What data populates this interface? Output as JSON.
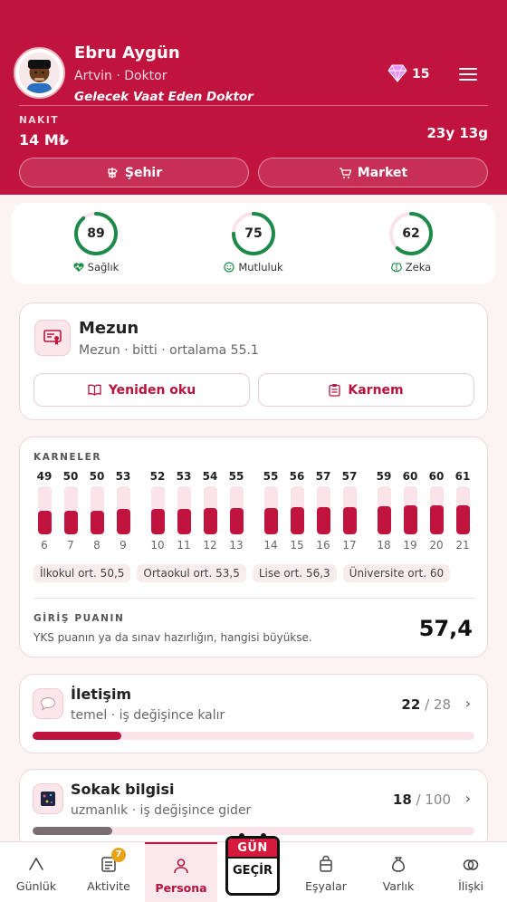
{
  "profile": {
    "name": "Ebru Aygün",
    "location": "Artvin · Doktor",
    "title": "Gelecek Vaat Eden Doktor",
    "gems": "15",
    "cash_label": "NAKIT",
    "cash": "14 M₺",
    "age": "23y 13g"
  },
  "header_buttons": {
    "city": "Şehir",
    "market": "Market"
  },
  "stats": [
    {
      "label": "Sağlık",
      "value": 89,
      "color": "#1e8a4a",
      "icon": "heart-pulse-icon"
    },
    {
      "label": "Mutluluk",
      "value": 75,
      "color": "#1e8a4a",
      "icon": "smile-icon"
    },
    {
      "label": "Zeka",
      "value": 62,
      "color": "#1e8a4a",
      "icon": "brain-icon"
    }
  ],
  "education": {
    "title": "Mezun",
    "subtitle": "Mezun · bitti · ortalama 55.1",
    "reread_label": "Yeniden oku",
    "report_label": "Karnem"
  },
  "report_cards": {
    "label": "KARNELER",
    "chips": [
      "İlkokul ort. 50,5",
      "Ortaokul ort. 53,5",
      "Lise ort. 56,3",
      "Üniversite ort. 60"
    ],
    "score_label": "GİRİŞ PUANIN",
    "score_note": "YKS puanın ya da sınav hazırlığın, hangisi büyükse.",
    "score": "57,4"
  },
  "chart_data": {
    "type": "bar",
    "categories": [
      "6",
      "7",
      "8",
      "9",
      "10",
      "11",
      "12",
      "13",
      "14",
      "15",
      "16",
      "17",
      "18",
      "19",
      "20",
      "21"
    ],
    "values": [
      49,
      50,
      50,
      53,
      52,
      53,
      54,
      55,
      55,
      56,
      57,
      57,
      59,
      60,
      60,
      61
    ],
    "title": "KARNELER",
    "ylim": [
      0,
      100
    ],
    "color": "#c0143f"
  },
  "skills": [
    {
      "title": "İletişim",
      "subtitle": "temel · iş değişince kalır",
      "value": "22",
      "max": "/ 28",
      "progress": 0.2,
      "color": "#c0143f",
      "icon": "speech-bubble-icon"
    },
    {
      "title": "Sokak bilgisi",
      "subtitle": "uzmanlık · iş değişince gider",
      "value": "18",
      "max": "/ 100",
      "progress": 0.18,
      "color": "#7a6e72",
      "icon": "street-map-icon"
    }
  ],
  "nav": {
    "items": [
      "Günlük",
      "Aktivite",
      "Persona",
      "Eşyalar",
      "Varlık",
      "İlişki"
    ],
    "activity_badge": "7",
    "day_top": "GÜN",
    "day_bottom": "GEÇİR"
  }
}
